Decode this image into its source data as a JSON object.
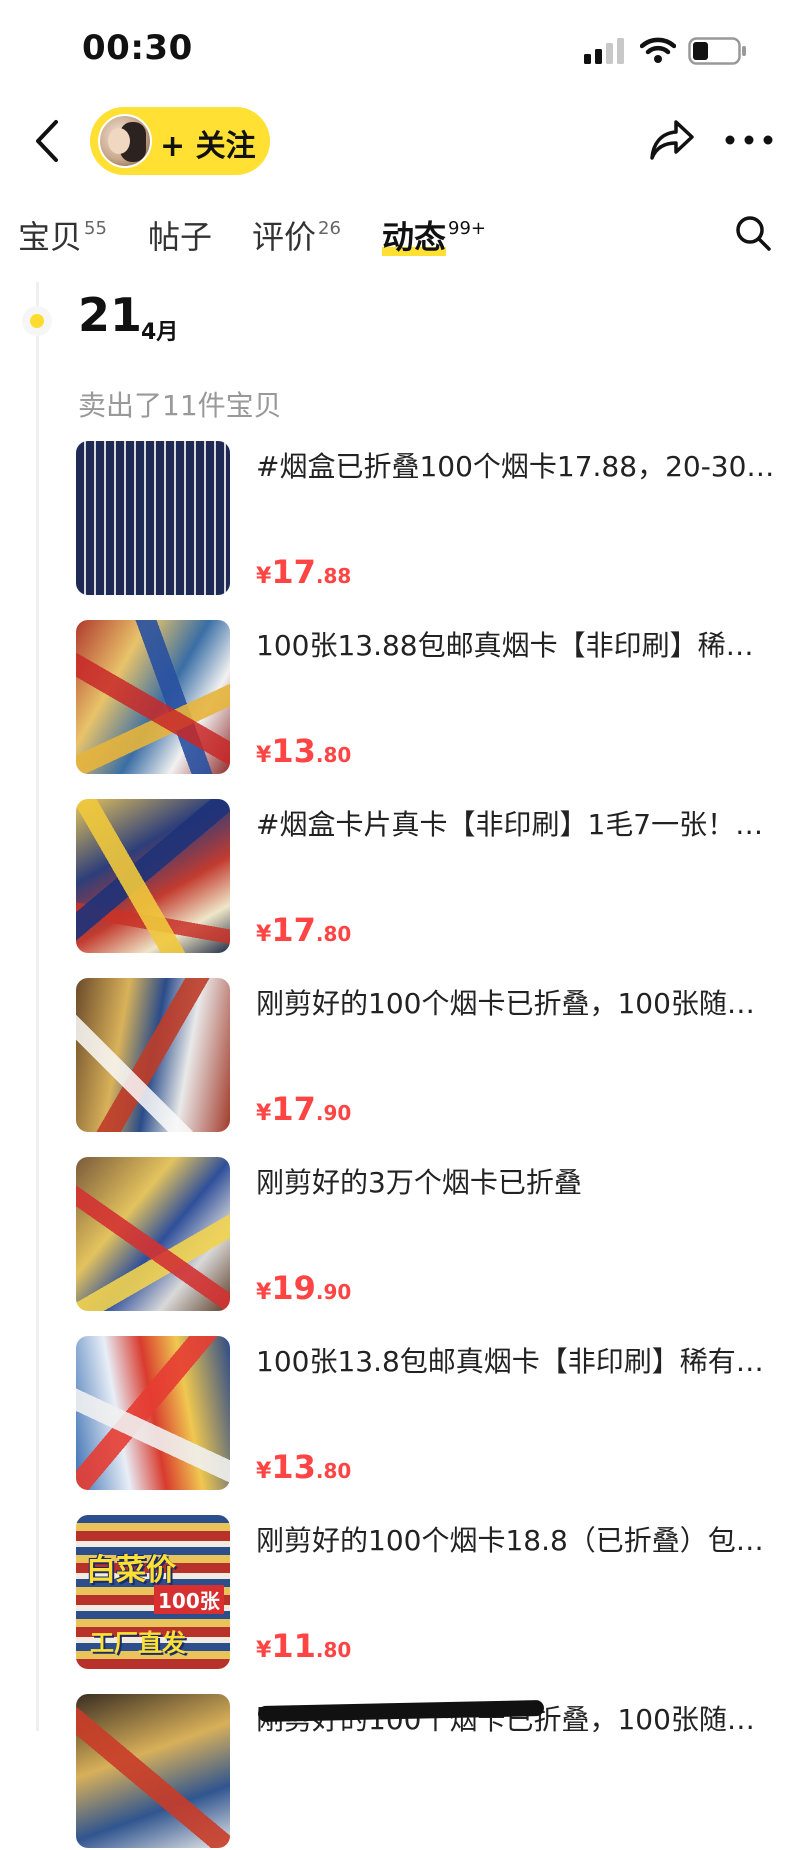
{
  "status_bar": {
    "time": "00:30"
  },
  "header": {
    "follow_label": "+ 关注"
  },
  "tabs": [
    {
      "label": "宝贝",
      "count": "55"
    },
    {
      "label": "帖子",
      "count": ""
    },
    {
      "label": "评价",
      "count": "26"
    },
    {
      "label": "动态",
      "count": "99+",
      "active": true
    }
  ],
  "timeline": {
    "day": "21",
    "month": "4月",
    "summary": "卖出了11件宝贝"
  },
  "items": [
    {
      "title": "#烟盒已折叠100个烟卡17.88，20-30…",
      "currency": "¥",
      "price_int": "17",
      "price_dec": ".88"
    },
    {
      "title": "100张13.88包邮真烟卡【非印刷】稀…",
      "currency": "¥",
      "price_int": "13",
      "price_dec": ".80"
    },
    {
      "title": "#烟盒卡片真卡【非印刷】1毛7一张！…",
      "currency": "¥",
      "price_int": "17",
      "price_dec": ".80"
    },
    {
      "title": "刚剪好的100个烟卡已折叠，100张随…",
      "currency": "¥",
      "price_int": "17",
      "price_dec": ".90"
    },
    {
      "title": "刚剪好的3万个烟卡已折叠",
      "currency": "¥",
      "price_int": "19",
      "price_dec": ".90"
    },
    {
      "title": "100张13.8包邮真烟卡【非印刷】稀有…",
      "currency": "¥",
      "price_int": "13",
      "price_dec": ".80"
    },
    {
      "title": "刚剪好的100个烟卡18.8（已折叠）包…",
      "currency": "¥",
      "price_int": "11",
      "price_dec": ".80",
      "thumb_text": {
        "main": "白菜价",
        "badge": "100张",
        "bottom": "工厂直发"
      }
    },
    {
      "title": "刚剪好的100个烟卡已折叠，100张随…"
    }
  ],
  "colors": {
    "accent_yellow": "#ffe033",
    "price_red": "#ff4444",
    "muted_gray": "#999999"
  },
  "icons": [
    "back-icon",
    "share-icon",
    "more-icon",
    "search-icon",
    "signal-icon",
    "wifi-icon",
    "battery-icon"
  ]
}
